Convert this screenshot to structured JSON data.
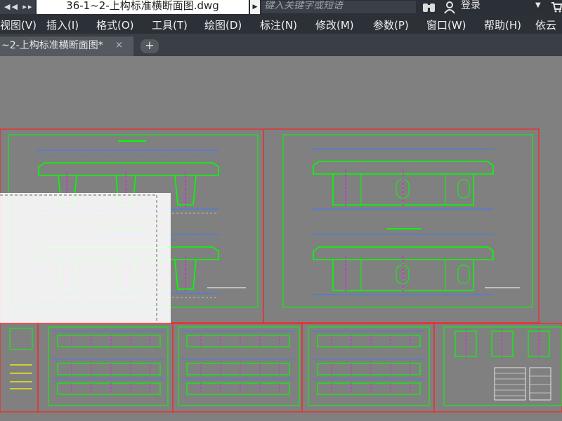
{
  "titlebar": {
    "nav_arrows": "◀◀ ▸▸",
    "filename": "36-1~2-上构标准横断面图.dwg",
    "search_placeholder": "键入关键字或短语",
    "login": "登录",
    "icons": [
      "binoculars-icon",
      "user-icon",
      "chevron-down-icon",
      "cart-icon"
    ]
  },
  "menu": {
    "items": [
      "视图(V)",
      "插入(I)",
      "格式(O)",
      "工具(T)",
      "绘图(D)",
      "标注(N)",
      "修改(M)",
      "参数(P)",
      "窗口(W)",
      "帮助(H)",
      "依云"
    ]
  },
  "tabs": {
    "active_label": "~2-上构标准横断面图*",
    "close_glyph": "×",
    "add_glyph": "+"
  },
  "colors": {
    "canvas_bg": "#808080",
    "frame_red": "#ff2020",
    "line_green": "#00ff00",
    "dim_blue": "#3c78ff",
    "axis_magenta": "#ff00ff",
    "selection_white": "#ffffff"
  }
}
